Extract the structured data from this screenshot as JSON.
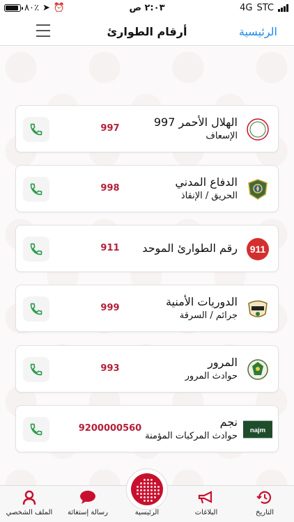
{
  "status_bar": {
    "battery": "٨٠٪",
    "battery_level": 0.8,
    "time": "٢:٠٣ ص",
    "network": "4G",
    "carrier": "STC"
  },
  "nav": {
    "title": "أرقام الطوارئ",
    "home_link": "الرئيسية"
  },
  "entries": [
    {
      "title": "الهلال الأحمر 997",
      "subtitle": "الإسعاف",
      "number": "997",
      "logo": "red-crescent-logo"
    },
    {
      "title": "الدفاع المدني",
      "subtitle": "الحريق / الإنقاذ",
      "number": "998",
      "logo": "civil-defense-logo"
    },
    {
      "title": "رقم الطوارئ الموحد",
      "subtitle": "",
      "number": "911",
      "logo": "911-logo"
    },
    {
      "title": "الدوريات الأمنية",
      "subtitle": "جرائم / السرقة",
      "number": "999",
      "logo": "security-patrols-logo"
    },
    {
      "title": "المرور",
      "subtitle": "حوادث المرور",
      "number": "993",
      "logo": "traffic-police-logo"
    },
    {
      "title": "نجم",
      "subtitle": "حوادث المركبات المؤمنة",
      "number": "9200000560",
      "logo": "najm-logo"
    }
  ],
  "tabs": [
    {
      "label": "الملف الشخصي",
      "icon": "profile-icon"
    },
    {
      "label": "رسالة إستغاثة",
      "icon": "chat-icon"
    },
    {
      "label": "الرئيسية",
      "icon": "home-dot-icon"
    },
    {
      "label": "البلاغات",
      "icon": "megaphone-icon"
    },
    {
      "label": "التاريخ",
      "icon": "history-icon"
    }
  ],
  "colors": {
    "accent": "#c8102e",
    "number": "#b3203a",
    "link": "#1e88e5",
    "call": "#2e9e4f"
  },
  "logo_text": {
    "911": "911",
    "najm": "najm"
  }
}
